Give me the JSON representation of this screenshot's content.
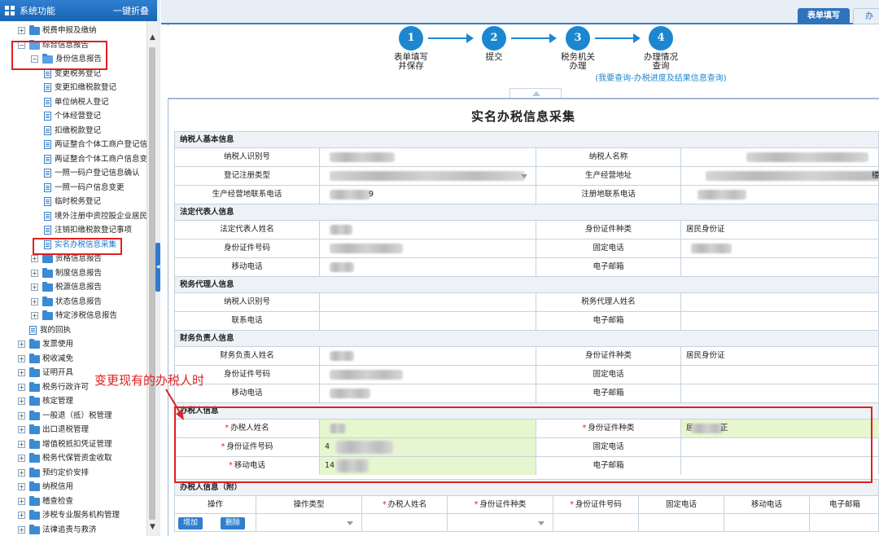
{
  "sidebar": {
    "title": "系统功能",
    "collapse_all": "一键折叠",
    "items": [
      {
        "label": "税费申报及缴纳",
        "level": 0,
        "type": "folder",
        "expanded": false
      },
      {
        "label": "综合信息报告",
        "level": 0,
        "type": "folder",
        "expanded": true
      },
      {
        "label": "身份信息报告",
        "level": 1,
        "type": "folder",
        "expanded": true
      },
      {
        "label": "变更税务登记",
        "level": 2,
        "type": "page"
      },
      {
        "label": "变更扣缴税款登记",
        "level": 2,
        "type": "page"
      },
      {
        "label": "单位纳税人登记",
        "level": 2,
        "type": "page"
      },
      {
        "label": "个体经营登记",
        "level": 2,
        "type": "page"
      },
      {
        "label": "扣缴税款登记",
        "level": 2,
        "type": "page"
      },
      {
        "label": "两证整合个体工商户登记信",
        "level": 2,
        "type": "page"
      },
      {
        "label": "两证整合个体工商户信息变",
        "level": 2,
        "type": "page"
      },
      {
        "label": "一照一码户登记信息确认",
        "level": 2,
        "type": "page"
      },
      {
        "label": "一照一码户信息变更",
        "level": 2,
        "type": "page"
      },
      {
        "label": "临时税务登记",
        "level": 2,
        "type": "page"
      },
      {
        "label": "境外注册中资控股企业居民",
        "level": 2,
        "type": "page"
      },
      {
        "label": "注销扣缴税款登记事项",
        "level": 2,
        "type": "page"
      },
      {
        "label": "实名办税信息采集",
        "level": 2,
        "type": "page",
        "selected": true
      },
      {
        "label": "资格信息报告",
        "level": 1,
        "type": "folder",
        "expanded": false
      },
      {
        "label": "制度信息报告",
        "level": 1,
        "type": "folder",
        "expanded": false
      },
      {
        "label": "税源信息报告",
        "level": 1,
        "type": "folder",
        "expanded": false
      },
      {
        "label": "状态信息报告",
        "level": 1,
        "type": "folder",
        "expanded": false
      },
      {
        "label": "特定涉税信息报告",
        "level": 1,
        "type": "folder",
        "expanded": false
      },
      {
        "label": "我的回执",
        "level": 0,
        "type": "page"
      },
      {
        "label": "发票使用",
        "level": 0,
        "type": "folder",
        "expanded": false
      },
      {
        "label": "税收减免",
        "level": 0,
        "type": "folder",
        "expanded": false
      },
      {
        "label": "证明开具",
        "level": 0,
        "type": "folder",
        "expanded": false
      },
      {
        "label": "税务行政许可",
        "level": 0,
        "type": "folder",
        "expanded": false
      },
      {
        "label": "核定管理",
        "level": 0,
        "type": "folder",
        "expanded": false
      },
      {
        "label": "一般退（抵）税管理",
        "level": 0,
        "type": "folder",
        "expanded": false
      },
      {
        "label": "出口退税管理",
        "level": 0,
        "type": "folder",
        "expanded": false
      },
      {
        "label": "增值税抵扣凭证管理",
        "level": 0,
        "type": "folder",
        "expanded": false
      },
      {
        "label": "税务代保管资金收取",
        "level": 0,
        "type": "folder",
        "expanded": false
      },
      {
        "label": "预约定价安排",
        "level": 0,
        "type": "folder",
        "expanded": false
      },
      {
        "label": "纳税信用",
        "level": 0,
        "type": "folder",
        "expanded": false
      },
      {
        "label": "稽查检查",
        "level": 0,
        "type": "folder",
        "expanded": false
      },
      {
        "label": "涉税专业服务机构管理",
        "level": 0,
        "type": "folder",
        "expanded": false
      },
      {
        "label": "法律追责与救济",
        "level": 0,
        "type": "folder",
        "expanded": false
      }
    ]
  },
  "tabs": {
    "active": "表单填写",
    "next": "办"
  },
  "steps": [
    {
      "num": "1",
      "label": [
        "表单填写",
        "并保存"
      ]
    },
    {
      "num": "2",
      "label": [
        "提交"
      ]
    },
    {
      "num": "3",
      "label": [
        "税务机关",
        "办理"
      ]
    },
    {
      "num": "4",
      "label": [
        "办理情况",
        "查询"
      ],
      "sub": "(我要查询-办税进度及结果信息查询)"
    }
  ],
  "page_title": "实名办税信息采集",
  "sections": {
    "basic": {
      "title": "纳税人基本信息",
      "rows": [
        {
          "l1": "纳税人识别号",
          "l2": "纳税人名称"
        },
        {
          "l1": "登记注册类型",
          "l2": "生产经营地址",
          "r2_tail": "楼"
        },
        {
          "l1": "生产经营地联系电话",
          "l2": "注册地联系电话",
          "v1_tail": "9"
        }
      ]
    },
    "legal": {
      "title": "法定代表人信息",
      "rows": [
        {
          "l1": "法定代表人姓名",
          "l2": "身份证件种类",
          "v2": "居民身份证"
        },
        {
          "l1": "身份证件号码",
          "l2": "固定电话"
        },
        {
          "l1": "移动电话",
          "l2": "电子邮箱"
        }
      ]
    },
    "agent": {
      "title": "税务代理人信息",
      "rows": [
        {
          "l1": "纳税人识别号",
          "l2": "税务代理人姓名"
        },
        {
          "l1": "联系电话",
          "l2": "电子邮箱"
        }
      ]
    },
    "finance": {
      "title": "财务负责人信息",
      "rows": [
        {
          "l1": "财务负责人姓名",
          "l2": "身份证件种类",
          "v2": "居民身份证"
        },
        {
          "l1": "身份证件号码",
          "l2": "固定电话"
        },
        {
          "l1": "移动电话",
          "l2": "电子邮箱"
        }
      ]
    },
    "handler": {
      "title": "办税人信息",
      "rows": [
        {
          "l1": "办税人姓名",
          "l2": "身份证件种类",
          "req1": true,
          "req2": true,
          "v2": "居",
          "v2_tail": "正"
        },
        {
          "l1": "身份证件号码",
          "l2": "固定电话",
          "req1": true,
          "v1": "4"
        },
        {
          "l1": "移动电话",
          "l2": "电子邮箱",
          "req1": true,
          "v1": "14"
        }
      ]
    },
    "handler_attached": {
      "title": "办税人信息（附）",
      "columns": [
        "操作",
        "操作类型",
        "办税人姓名",
        "身份证件种类",
        "身份证件号码",
        "固定电话",
        "移动电话",
        "电子邮箱"
      ],
      "add_label": "增加",
      "delete_label": "删除"
    }
  },
  "annotation": "变更现有的办税人时",
  "colors": {
    "accent": "#1c87d0",
    "highlight": "#e02020",
    "required_bg": "#e6f7cf"
  }
}
